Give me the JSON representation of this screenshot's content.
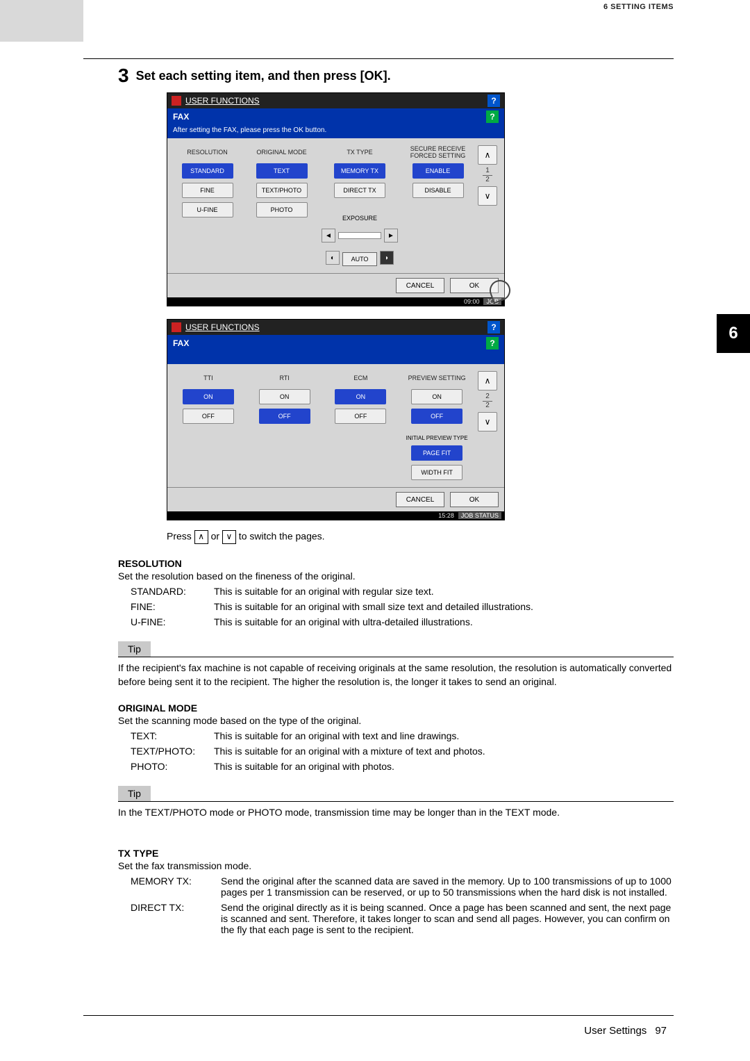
{
  "header": {
    "section": "6  SETTING ITEMS"
  },
  "side_tab": {
    "num": "6"
  },
  "step": {
    "num": "3",
    "text": "Set each setting item, and then press [OK]."
  },
  "panel1": {
    "title": "USER FUNCTIONS",
    "bar": "FAX",
    "sub": "After setting the FAX, please press the OK button.",
    "cols": {
      "resolution": {
        "head": "RESOLUTION",
        "b1": "STANDARD",
        "b2": "FINE",
        "b3": "U-FINE"
      },
      "original": {
        "head": "ORIGINAL MODE",
        "b1": "TEXT",
        "b2": "TEXT/PHOTO",
        "b3": "PHOTO"
      },
      "txtype": {
        "head": "TX TYPE",
        "b1": "MEMORY TX",
        "b2": "DIRECT TX",
        "expo": "EXPOSURE",
        "auto": "AUTO"
      },
      "secure": {
        "head": "SECURE RECEIVE FORCED SETTING",
        "b1": "ENABLE",
        "b2": "DISABLE"
      }
    },
    "pg": {
      "cur": "1",
      "tot": "2"
    },
    "footer": {
      "cancel": "CANCEL",
      "ok": "OK"
    },
    "status_time": "09:00"
  },
  "panel2": {
    "title": "USER FUNCTIONS",
    "bar": "FAX",
    "cols": {
      "tti": {
        "head": "TTI",
        "b1": "ON",
        "b2": "OFF"
      },
      "rti": {
        "head": "RTI",
        "b1": "ON",
        "b2": "OFF"
      },
      "ecm": {
        "head": "ECM",
        "b1": "ON",
        "b2": "OFF"
      },
      "preview": {
        "head": "PREVIEW SETTING",
        "b1": "ON",
        "b2": "OFF",
        "initial": "INITIAL PREVIEW TYPE",
        "b3": "PAGE FIT",
        "b4": "WIDTH FIT"
      }
    },
    "pg": {
      "cur": "2",
      "tot": "2"
    },
    "footer": {
      "cancel": "CANCEL",
      "ok": "OK"
    },
    "status_time": "15:28",
    "status_job": "JOB STATUS"
  },
  "below": {
    "press1": "Press ",
    "press2": " or ",
    "press3": " to switch the pages."
  },
  "resolution": {
    "head": "RESOLUTION",
    "desc": "Set the resolution based on the fineness of the original.",
    "rows": [
      {
        "term": "STANDARD:",
        "def": "This is suitable for an original with regular size text."
      },
      {
        "term": "FINE:",
        "def": "This is suitable for an original with small size text and detailed illustrations."
      },
      {
        "term": "U-FINE:",
        "def": "This is suitable for an original with ultra-detailed illustrations."
      }
    ],
    "tip_label": "Tip",
    "tip": "If the recipient's fax machine is not capable of receiving originals at the same resolution, the resolution is automatically converted before being sent it to the recipient. The higher the resolution is, the longer it takes to send an original."
  },
  "original": {
    "head": "ORIGINAL MODE",
    "desc": "Set the scanning mode based on the type of the original.",
    "rows": [
      {
        "term": "TEXT:",
        "def": "This is suitable for an original with text and line drawings."
      },
      {
        "term": "TEXT/PHOTO:",
        "def": "This is suitable for an original with a mixture of text and photos."
      },
      {
        "term": "PHOTO:",
        "def": "This is suitable for an original with photos."
      }
    ],
    "tip_label": "Tip",
    "tip": "In the TEXT/PHOTO mode or PHOTO mode, transmission time may be longer than in the TEXT mode."
  },
  "txtype": {
    "head": "TX TYPE",
    "desc": "Set the fax transmission mode.",
    "rows": [
      {
        "term": "MEMORY TX:",
        "def": "Send the original after the scanned data are saved in the memory. Up to 100 transmissions of up to 1000 pages per 1 transmission can be reserved, or up to 50 transmissions when the hard disk is not installed."
      },
      {
        "term": "DIRECT TX:",
        "def": "Send the original directly as it is being scanned. Once a page has been scanned and sent, the next page is scanned and sent. Therefore, it takes longer to scan and send all pages. However, you can confirm on the fly that each page is sent to the recipient."
      }
    ]
  },
  "footer_page": {
    "label": "User Settings",
    "num": "97"
  }
}
